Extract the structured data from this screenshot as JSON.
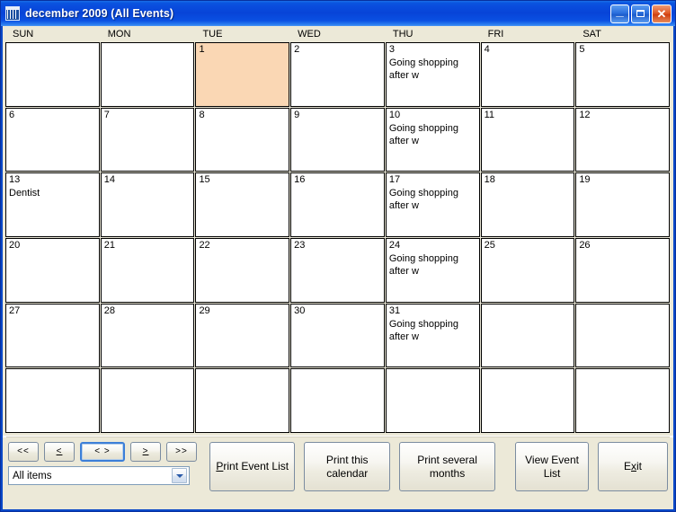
{
  "window": {
    "title": "december 2009 (All Events)",
    "icon": "calendar-grid-icon",
    "buttons": {
      "minimize": "_",
      "maximize": "",
      "close": "✕"
    },
    "colors": {
      "title_bar": "#0744d8",
      "client_background": "#ece9d8",
      "cell_background": "#ffffff",
      "highlight_day": "#fad7b4",
      "close_button": "#cf3f10"
    }
  },
  "calendar": {
    "month": "december",
    "year": "2009",
    "filter_label": "All Events",
    "day_headers": [
      "SUN",
      "MON",
      "TUE",
      "WED",
      "THU",
      "FRI",
      "SAT"
    ],
    "rows": [
      [
        {
          "day": "",
          "events": [],
          "highlight": false
        },
        {
          "day": "",
          "events": [],
          "highlight": false
        },
        {
          "day": "1",
          "events": [],
          "highlight": true
        },
        {
          "day": "2",
          "events": [],
          "highlight": false
        },
        {
          "day": "3",
          "events": [
            "Going shopping",
            "after w"
          ],
          "highlight": false
        },
        {
          "day": "4",
          "events": [],
          "highlight": false
        },
        {
          "day": "5",
          "events": [],
          "highlight": false
        }
      ],
      [
        {
          "day": "6",
          "events": [],
          "highlight": false
        },
        {
          "day": "7",
          "events": [],
          "highlight": false
        },
        {
          "day": "8",
          "events": [],
          "highlight": false
        },
        {
          "day": "9",
          "events": [],
          "highlight": false
        },
        {
          "day": "10",
          "events": [
            "Going shopping",
            "after w"
          ],
          "highlight": false
        },
        {
          "day": "11",
          "events": [],
          "highlight": false
        },
        {
          "day": "12",
          "events": [],
          "highlight": false
        }
      ],
      [
        {
          "day": "13",
          "events": [
            "Dentist"
          ],
          "highlight": false
        },
        {
          "day": "14",
          "events": [],
          "highlight": false
        },
        {
          "day": "15",
          "events": [],
          "highlight": false
        },
        {
          "day": "16",
          "events": [],
          "highlight": false
        },
        {
          "day": "17",
          "events": [
            "Going shopping",
            "after w"
          ],
          "highlight": false
        },
        {
          "day": "18",
          "events": [],
          "highlight": false
        },
        {
          "day": "19",
          "events": [],
          "highlight": false
        }
      ],
      [
        {
          "day": "20",
          "events": [],
          "highlight": false
        },
        {
          "day": "21",
          "events": [],
          "highlight": false
        },
        {
          "day": "22",
          "events": [],
          "highlight": false
        },
        {
          "day": "23",
          "events": [],
          "highlight": false
        },
        {
          "day": "24",
          "events": [
            "Going shopping",
            "after w"
          ],
          "highlight": false
        },
        {
          "day": "25",
          "events": [],
          "highlight": false
        },
        {
          "day": "26",
          "events": [],
          "highlight": false
        }
      ],
      [
        {
          "day": "27",
          "events": [],
          "highlight": false
        },
        {
          "day": "28",
          "events": [],
          "highlight": false
        },
        {
          "day": "29",
          "events": [],
          "highlight": false
        },
        {
          "day": "30",
          "events": [],
          "highlight": false
        },
        {
          "day": "31",
          "events": [
            "Going shopping",
            "after w"
          ],
          "highlight": false
        },
        {
          "day": "",
          "events": [],
          "highlight": false
        },
        {
          "day": "",
          "events": [],
          "highlight": false
        }
      ],
      [
        {
          "day": "",
          "events": [],
          "highlight": false
        },
        {
          "day": "",
          "events": [],
          "highlight": false
        },
        {
          "day": "",
          "events": [],
          "highlight": false
        },
        {
          "day": "",
          "events": [],
          "highlight": false
        },
        {
          "day": "",
          "events": [],
          "highlight": false
        },
        {
          "day": "",
          "events": [],
          "highlight": false
        },
        {
          "day": "",
          "events": [],
          "highlight": false
        }
      ]
    ]
  },
  "toolbar": {
    "nav": {
      "first_label": "<<",
      "prev_label": "<",
      "today_label": "< >",
      "next_label": ">",
      "last_label": ">>",
      "focused": "today"
    },
    "filter": {
      "value": "All items",
      "arrow_icon": "chevron-down-icon"
    },
    "print_event_list": "Print Event List",
    "print_this_calendar": "Print this calendar",
    "print_several_months": "Print several months",
    "view_event_list_line1": "View Event",
    "view_event_list_line2": "List",
    "exit_label": "Exit"
  }
}
